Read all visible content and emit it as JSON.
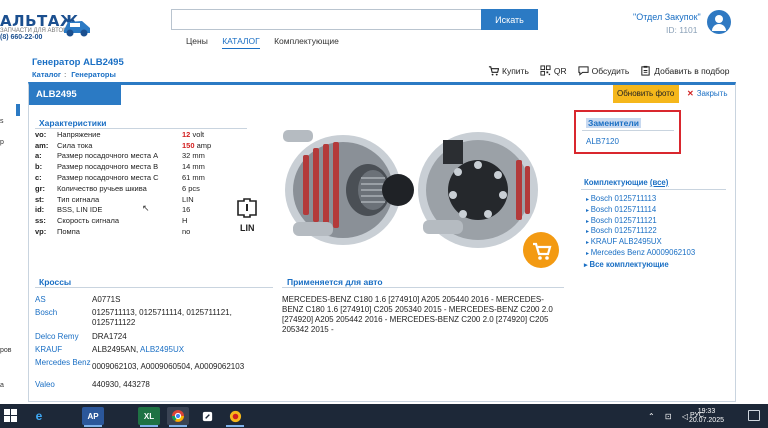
{
  "header": {
    "logo_text": "АЛЬТАЖ",
    "logo_sub": "ЗАПЧАСТИ ДЛЯ АВТОМАТИКИ",
    "logo_phone": "(8) 660-22-00",
    "search_placeholder": "",
    "search_button": "Искать",
    "nav": [
      "Цены",
      "КАТАЛОГ",
      "Комплектующие"
    ],
    "active_nav": "КАТАЛОГ",
    "user_name": "\"Отдел Закупок\"",
    "user_id": "ID: 1101"
  },
  "page": {
    "title": "Генератор ALB2495",
    "breadcrumb": [
      "Каталог",
      "Генераторы"
    ],
    "actions": [
      "Купить",
      "QR",
      "Обсудить",
      "Добавить в подбор"
    ]
  },
  "left_strip": [
    "s",
    "р",
    "",
    "ров",
    "а"
  ],
  "card": {
    "article": "ALB2495",
    "update_photo": "Обновить фото",
    "close": "Закрыть",
    "specs_title": "Характеристики",
    "specs": [
      {
        "k": "vo:",
        "name": "Напряжение",
        "val": "12",
        "unit": "volt",
        "highlight": true
      },
      {
        "k": "am:",
        "name": "Сила тока",
        "val": "150",
        "unit": "amp",
        "highlight": true
      },
      {
        "k": "a:",
        "name": "Размер посадочного места A",
        "val": "32 mm",
        "unit": "",
        "highlight": false
      },
      {
        "k": "b:",
        "name": "Размер посадочного места B",
        "val": "14 mm",
        "unit": "",
        "highlight": false
      },
      {
        "k": "c:",
        "name": "Размер посадочного места C",
        "val": "61 mm",
        "unit": "",
        "highlight": false
      },
      {
        "k": "gr:",
        "name": "Количество ручьев шкива",
        "val": "6 pcs",
        "unit": "",
        "highlight": false
      },
      {
        "k": "st:",
        "name": "Тип сигнала",
        "val": "LIN",
        "unit": "",
        "highlight": false
      },
      {
        "k": "id:",
        "name": "BSS, LIN IDE",
        "val": "16",
        "unit": "",
        "highlight": false
      },
      {
        "k": "ss:",
        "name": "Скорость сигнала",
        "val": "H",
        "unit": "",
        "highlight": false
      },
      {
        "k": "vp:",
        "name": "Помпа",
        "val": "no",
        "unit": "",
        "highlight": false
      }
    ],
    "lin_label": "LIN",
    "replacements_title": "Заменители",
    "replacements": [
      "ALB7120"
    ],
    "complects_title": "Комплектующие",
    "complects_all_link": "(все)",
    "complects": [
      "Bosch 0125711113",
      "Bosch 0125711114",
      "Bosch 0125711121",
      "Bosch 0125711122",
      "KRAUF ALB2495UX",
      "Mercedes Benz A0009062103"
    ],
    "complects_all": "Все комплектующие",
    "crosses_title": "Кроссы",
    "crosses": [
      {
        "maker": "AS",
        "codes": "A0771S"
      },
      {
        "maker": "Bosch",
        "codes": "0125711113, 0125711114, 0125711121, 0125711122"
      },
      {
        "maker": "Delco Remy",
        "codes": "DRA1724"
      },
      {
        "maker": "KRAUF",
        "codes": "ALB2495AN, ",
        "link": "ALB2495UX"
      },
      {
        "maker": "Mercedes Benz",
        "codes": "0009062103, A0009060504, A0009062103"
      },
      {
        "maker": "Valeo",
        "codes": "440930, 443278"
      }
    ],
    "applies_title": "Применяется для авто",
    "applies_text": "MERCEDES-BENZ C180 1.6 [274910] A205 205440 2016 - MERCEDES-BENZ C180 1.6 [274910] C205 205340 2015 - MERCEDES-BENZ C200 2.0 [274920] A205 205442 2016 - MERCEDES-BENZ C200 2.0 [274920] C205 205342 2015 -"
  },
  "taskbar": {
    "apps": [
      "IE",
      "AP",
      "XL",
      "Chrome",
      "Files",
      "App"
    ],
    "lang": "РУС",
    "time": "19:33",
    "date": "20.07.2025"
  },
  "colors": {
    "accent": "#2b7ac4",
    "highlight_red": "#d32020",
    "update_photo_bg": "#f5b71b",
    "replacement_border": "#d9272e",
    "cart_orange": "#f39a12"
  }
}
